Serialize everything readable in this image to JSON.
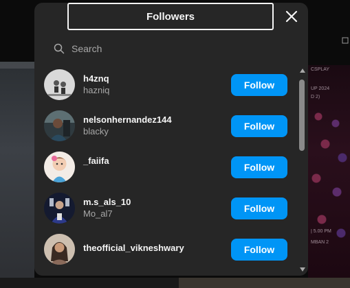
{
  "modal": {
    "title": "Followers",
    "close_icon": "close-icon"
  },
  "search": {
    "placeholder": "Search",
    "icon": "search-icon"
  },
  "followers": [
    {
      "username": "h4znq",
      "full_name": "hazniq",
      "button": "Follow"
    },
    {
      "username": "nelsonhernandez144",
      "full_name": "blacky",
      "button": "Follow"
    },
    {
      "username": "_faiifa",
      "full_name": "",
      "button": "Follow"
    },
    {
      "username": "m.s_als_10",
      "full_name": "Mo_al7",
      "button": "Follow"
    },
    {
      "username": "theofficial_vikneshwary",
      "full_name": "",
      "button": "Follow"
    }
  ],
  "background": {
    "poster_text": [
      "CSPLAY",
      "UP 2024",
      "D 2)",
      "| 5.00 PM",
      "MBAN 2"
    ]
  },
  "colors": {
    "modal_bg": "#262626",
    "button_blue": "#0095f6",
    "text_primary": "#f5f5f5",
    "text_secondary": "#a8a8a8"
  }
}
